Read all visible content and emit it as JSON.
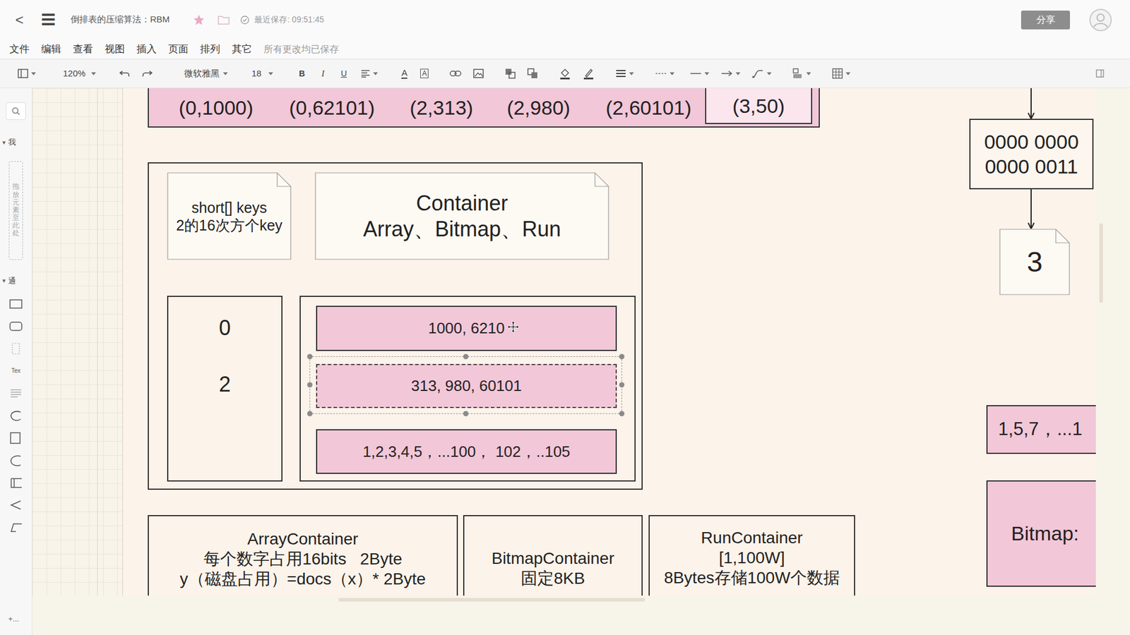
{
  "header": {
    "back": "<",
    "menu": "☰",
    "title": "倒排表的压缩算法：RBM",
    "saved": "最近保存: 09:51:45",
    "share": "分享"
  },
  "menubar": {
    "items": [
      "文件",
      "编辑",
      "查看",
      "视图",
      "插入",
      "页面",
      "排列",
      "其它"
    ],
    "status": "所有更改均已保存"
  },
  "toolbar": {
    "zoom": "120%",
    "font": "微软雅黑",
    "size": "18",
    "bold": "B",
    "italic": "I",
    "underline": "U",
    "font_color": "A",
    "font_bg": "A"
  },
  "sidebar": {
    "sections": [
      {
        "toggle": "▾",
        "label": "我",
        "expanded": true
      },
      {
        "toggle": "▾",
        "label": "通",
        "expanded": true
      }
    ],
    "drop_hint": "拖放元素至此处",
    "text_shape": "Tex",
    "more": "+..."
  },
  "diagram": {
    "tuples": [
      {
        "text": "(0,1000)",
        "boxed": false
      },
      {
        "text": "(0,62101)",
        "boxed": false
      },
      {
        "text": "(2,313)",
        "boxed": false
      },
      {
        "text": "(2,980)",
        "boxed": false
      },
      {
        "text": "(2,60101)",
        "boxed": false
      },
      {
        "text": "(3,50)",
        "boxed": true
      }
    ],
    "keys_doc": [
      "short[] keys",
      "2的16次方个key"
    ],
    "container_doc": [
      "Container",
      "Array、Bitmap、Run"
    ],
    "keys": [
      "0",
      "2"
    ],
    "rows": [
      {
        "text": "1000, 6210",
        "selected": false
      },
      {
        "text": "313, 980, 60101",
        "selected": true
      },
      {
        "text": "1,2,3,4,5，...100， 102，..105",
        "selected": false
      }
    ],
    "types": [
      {
        "lines": [
          "ArrayContainer",
          "每个数字占用16bits   2Byte",
          "y（磁盘占用）=docs（x）* 2Byte"
        ]
      },
      {
        "lines": [
          "BitmapContainer",
          "固定8KB"
        ]
      },
      {
        "lines": [
          "RunContainer",
          "[1,100W]",
          "8Bytes存储100W个数据"
        ]
      }
    ],
    "binary": [
      "0000 0000",
      "0000 0011"
    ],
    "result": "3",
    "run_list": "1,5,7，...1",
    "bitmap_label": "Bitmap:"
  }
}
